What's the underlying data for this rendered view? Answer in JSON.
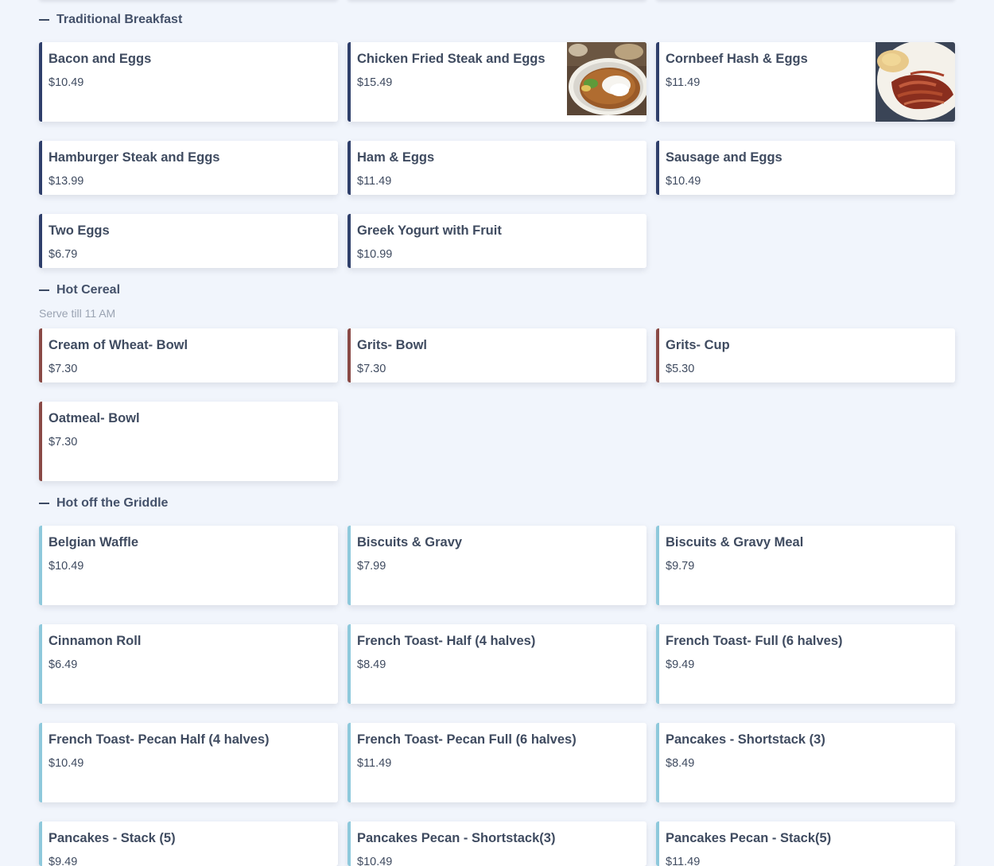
{
  "sections": {
    "traditional": {
      "title": "Traditional Breakfast",
      "items": [
        {
          "name": "Bacon and Eggs",
          "price": "$10.49"
        },
        {
          "name": "Chicken Fried Steak and Eggs",
          "price": "$15.49",
          "image": "chicken-fried-steak-photo"
        },
        {
          "name": "Cornbeef Hash & Eggs",
          "price": "$11.49",
          "image": "cornbeef-hash-bacon-photo"
        },
        {
          "name": "Hamburger Steak and Eggs",
          "price": "$13.99"
        },
        {
          "name": "Ham & Eggs",
          "price": "$11.49"
        },
        {
          "name": "Sausage and Eggs",
          "price": "$10.49"
        },
        {
          "name": "Two Eggs",
          "price": "$6.79"
        },
        {
          "name": "Greek Yogurt with Fruit",
          "price": "$10.99"
        }
      ]
    },
    "hot_cereal": {
      "title": "Hot Cereal",
      "note": "Serve till 11 AM",
      "items": [
        {
          "name": "Cream of Wheat- Bowl",
          "price": "$7.30"
        },
        {
          "name": "Grits- Bowl",
          "price": "$7.30"
        },
        {
          "name": "Grits- Cup",
          "price": "$5.30"
        },
        {
          "name": "Oatmeal- Bowl",
          "price": "$7.30"
        }
      ]
    },
    "griddle": {
      "title": "Hot off the Griddle",
      "items": [
        {
          "name": "Belgian Waffle",
          "price": "$10.49"
        },
        {
          "name": "Biscuits & Gravy",
          "price": "$7.99"
        },
        {
          "name": "Biscuits & Gravy Meal",
          "price": "$9.79"
        },
        {
          "name": "Cinnamon Roll",
          "price": "$6.49"
        },
        {
          "name": "French Toast- Half (4 halves)",
          "price": "$8.49"
        },
        {
          "name": "French Toast- Full (6 halves)",
          "price": "$9.49"
        },
        {
          "name": "French Toast- Pecan Half (4 halves)",
          "price": "$10.49"
        },
        {
          "name": "French Toast- Pecan Full (6 halves)",
          "price": "$11.49"
        },
        {
          "name": "Pancakes - Shortstack (3)",
          "price": "$8.49"
        },
        {
          "name": "Pancakes - Stack (5)",
          "price": "$9.49"
        },
        {
          "name": "Pancakes Pecan - Shortstack(3)",
          "price": "$10.49"
        },
        {
          "name": "Pancakes Pecan - Stack(5)",
          "price": "$11.49"
        }
      ]
    }
  },
  "colors": {
    "background": "#f1f5fc",
    "traditional_accent": "#2f3f6b",
    "cereal_accent": "#8a4a46",
    "griddle_accent": "#8ec9dc",
    "text": "#3f4b60",
    "note_text": "#9aa3b2"
  }
}
